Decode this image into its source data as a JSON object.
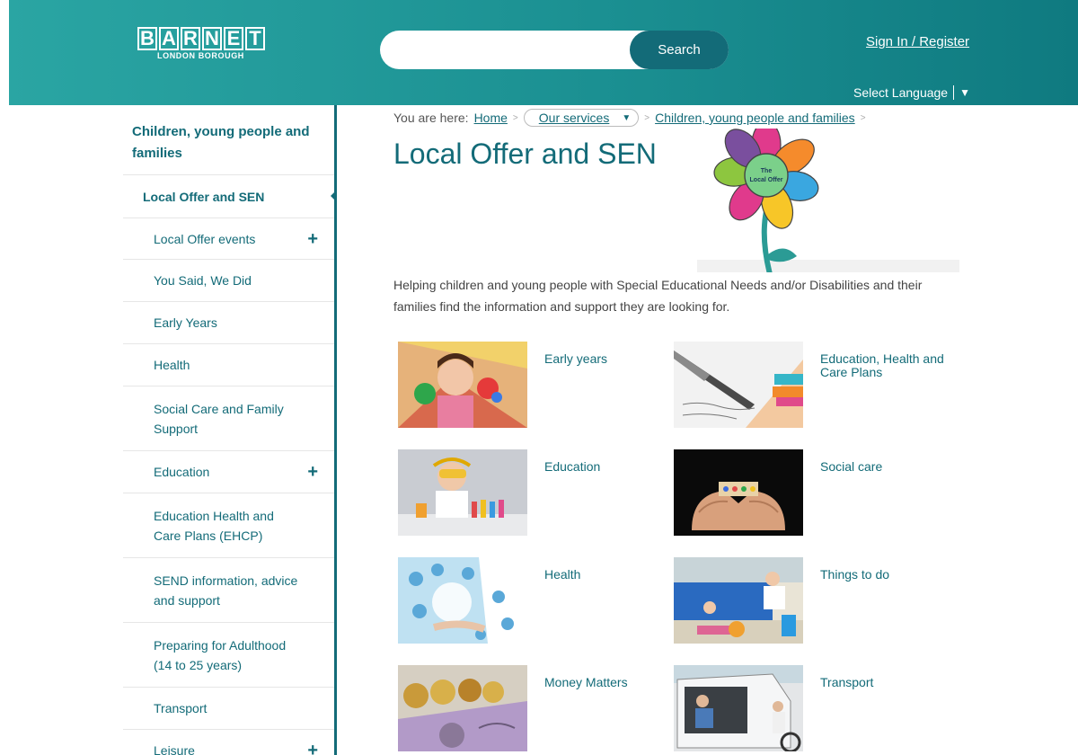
{
  "header": {
    "logo_letters": [
      "B",
      "A",
      "R",
      "N",
      "E",
      "T"
    ],
    "logo_sub": "LONDON BOROUGH",
    "search_placeholder": "",
    "search_button": "Search",
    "signin": "Sign In / Register",
    "language": "Select Language",
    "language_arrow": "▼"
  },
  "sidebar": {
    "section": "Children, young people and families",
    "active": "Local Offer and SEN",
    "items": [
      {
        "label": "Local Offer events",
        "expandable": true
      },
      {
        "label": "You Said, We Did",
        "expandable": false
      },
      {
        "label": "Early Years",
        "expandable": false
      },
      {
        "label": "Health",
        "expandable": false
      },
      {
        "label": "Social Care and Family Support",
        "expandable": false
      },
      {
        "label": "Education",
        "expandable": true
      },
      {
        "label": "Education Health and Care Plans (EHCP)",
        "expandable": false
      },
      {
        "label": "SEND information, advice and support",
        "expandable": false
      },
      {
        "label": "Preparing for Adulthood (14 to 25 years)",
        "expandable": false
      },
      {
        "label": "Transport",
        "expandable": false
      },
      {
        "label": "Leisure",
        "expandable": true
      }
    ]
  },
  "breadcrumb": {
    "prefix": "You are here:",
    "home": "Home",
    "services": "Our services",
    "current": "Children, young people and families"
  },
  "main": {
    "title": "Local Offer and SEN",
    "flower_text_1": "The",
    "flower_text_2": "Local Offer",
    "intro": "Helping children and young people with Special Educational Needs and/or Disabilities and their families find the information and support they are looking for.",
    "tiles": [
      {
        "label": "Early years"
      },
      {
        "label": "Education, Health and Care Plans"
      },
      {
        "label": "Education"
      },
      {
        "label": "Social care"
      },
      {
        "label": "Health"
      },
      {
        "label": "Things to do"
      },
      {
        "label": "Money Matters"
      },
      {
        "label": "Transport"
      }
    ]
  },
  "colors": {
    "teal": "#1b9092",
    "dark_teal": "#136b78"
  }
}
